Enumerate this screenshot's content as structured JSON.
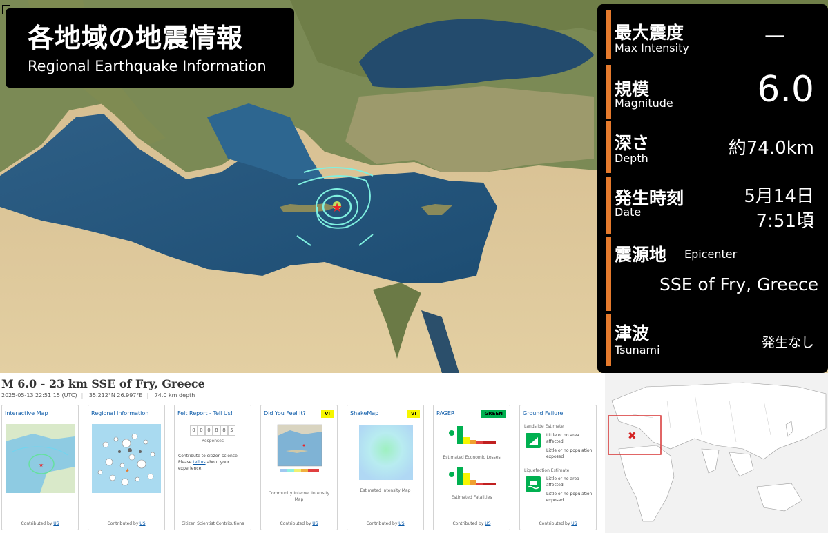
{
  "title": {
    "jp": "各地域の地震情報",
    "en": "Regional Earthquake Information"
  },
  "info": {
    "max_intensity": {
      "label_jp": "最大震度",
      "label_en": "Max  Intensity",
      "value": "—"
    },
    "magnitude": {
      "label_jp": "規模",
      "label_en": "Magnitude",
      "value": "6.0"
    },
    "depth": {
      "label_jp": "深さ",
      "label_en": "Depth",
      "value": "約74.0km"
    },
    "date": {
      "label_jp": "発生時刻",
      "label_en": "Date",
      "value_day": "5月14日",
      "value_time": "7:51頃"
    },
    "epicenter": {
      "label_jp": "震源地",
      "label_en": "Epicenter",
      "value": "SSE of Fry, Greece"
    },
    "tsunami": {
      "label_jp": "津波",
      "label_en": "Tsunami",
      "value": "発生なし"
    },
    "accent_color": "#e57a2d"
  },
  "usgs": {
    "title": "M 6.0 - 23 km SSE of Fry, Greece",
    "time": "2025-05-13 22:51:15 (UTC)",
    "location": "35.212°N 26.997°E",
    "depth": "74.0 km depth",
    "contributed_by": "Contributed by",
    "us_link": "US",
    "cards": {
      "interactive_map": {
        "title": "Interactive Map"
      },
      "regional": {
        "title": "Regional Information"
      },
      "felt": {
        "title": "Felt Report - Tell Us!",
        "digits": [
          "0",
          "0",
          "0",
          "8",
          "8",
          "5"
        ],
        "responses": "Responses",
        "line1": "Contribute to citizen science.",
        "line2_a": "Please ",
        "line2_link": "tell us",
        "line2_b": " about your",
        "line3": "experience.",
        "foot": "Citizen Scientist Contributions"
      },
      "dyfi": {
        "title": "Did You Feel It?",
        "badge": "VI",
        "caption1": "Community Internet Intensity",
        "caption2": "Map"
      },
      "shakemap": {
        "title": "ShakeMap",
        "badge": "VI",
        "caption": "Estimated Intensity Map"
      },
      "pager": {
        "title": "PAGER",
        "badge": "GREEN",
        "caption1": "Estimated Economic Losses",
        "caption2": "Estimated Fatalities"
      },
      "ground": {
        "title": "Ground Failure",
        "landslide": "Landslide Estimate",
        "ls_area1": "Little or no area",
        "ls_area2": "affected",
        "ls_pop1": "Little or no population",
        "ls_pop2": "exposed",
        "liquefaction": "Liquefaction Estimate",
        "lq_area1": "Little or no area",
        "lq_area2": "affected",
        "lq_pop1": "Little or no population",
        "lq_pop2": "exposed"
      }
    },
    "badge_yellow": "#f6f600",
    "badge_green": "#00b050"
  }
}
